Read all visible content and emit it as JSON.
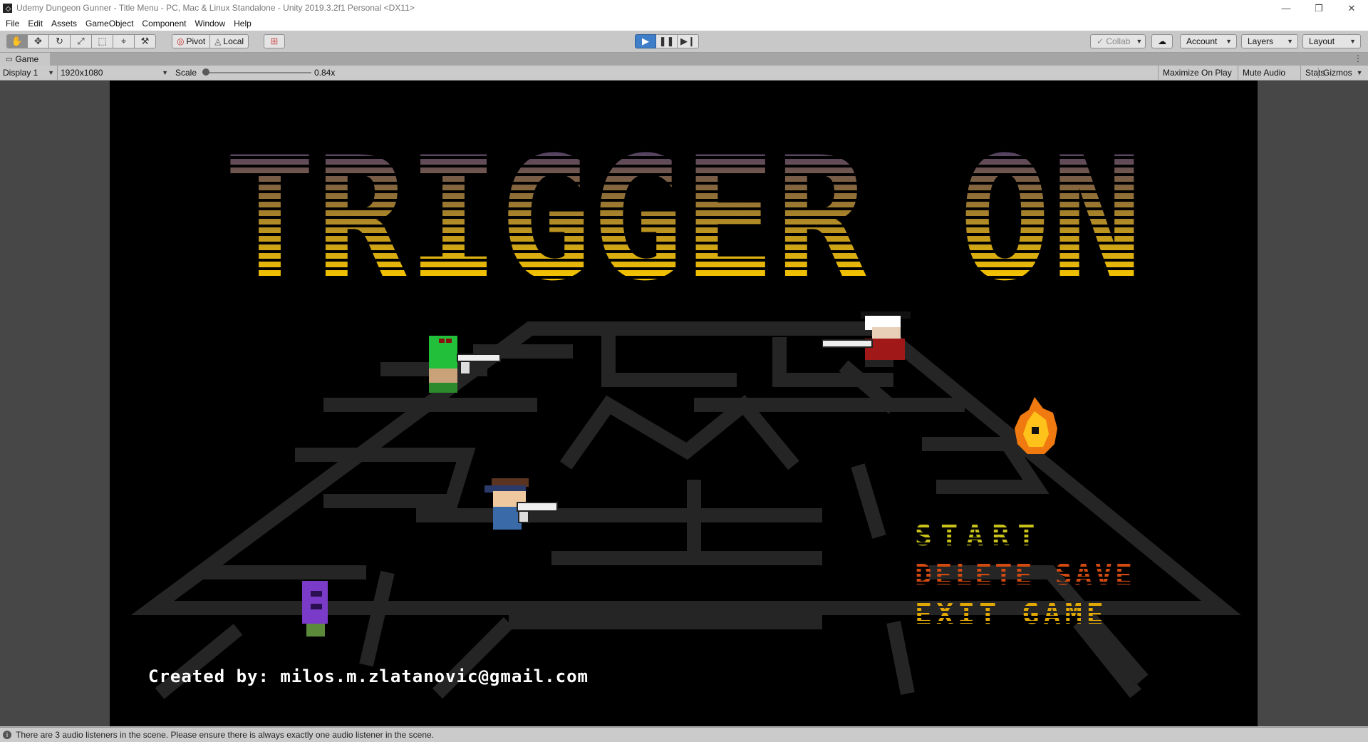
{
  "window": {
    "title": "Udemy Dungeon Gunner - Title Menu - PC, Mac & Linux Standalone - Unity 2019.3.2f1 Personal <DX11>",
    "controls": [
      "minimize-icon",
      "restore-icon",
      "close-icon"
    ]
  },
  "menu": [
    "File",
    "Edit",
    "Assets",
    "GameObject",
    "Component",
    "Window",
    "Help"
  ],
  "toolbar": {
    "tools": [
      "hand-icon",
      "move-icon",
      "rotate-icon",
      "scale-icon",
      "rect-icon",
      "transform-icon",
      "custom-tool-icon"
    ],
    "active_tool": "hand-icon",
    "pivot_label": "Pivot",
    "local_label": "Local",
    "playback": [
      "play-icon",
      "pause-icon",
      "step-icon"
    ],
    "playing": true,
    "collab_label": "Collab",
    "account_label": "Account",
    "layers_label": "Layers",
    "layout_label": "Layout"
  },
  "game_tab": {
    "label": "Game"
  },
  "game_toolbar": {
    "display": "Display 1",
    "resolution": "1920x1080",
    "scale_label": "Scale",
    "scale_value": "0.84x",
    "maximize_label": "Maximize On Play",
    "mute_label": "Mute Audio",
    "stats_label": "Stats",
    "gizmos_label": "Gizmos"
  },
  "game": {
    "title": "TRIGGER ON",
    "buttons": {
      "start": "START",
      "delete_save": "DELETE SAVE",
      "exit_game": "EXIT GAME"
    },
    "credits": "Created by: milos.m.zlatanovic@gmail.com",
    "colors": {
      "title_top": "#4a3a6a",
      "title_bottom": "#f5c400",
      "start": "#c9c21a",
      "delete_save": "#d24a10",
      "exit_game": "#e0a800",
      "maze": "#262525"
    }
  },
  "status": {
    "message": "There are 3 audio listeners in the scene. Please ensure there is always exactly one audio listener in the scene."
  }
}
